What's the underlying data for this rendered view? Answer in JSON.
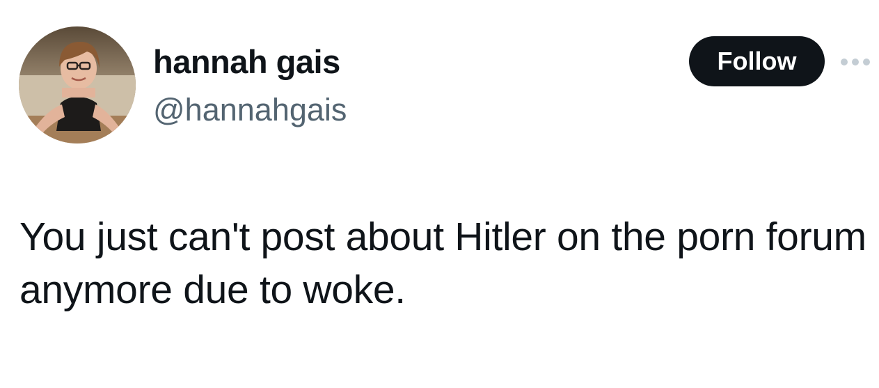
{
  "author": {
    "display_name": "hannah gais",
    "handle": "@hannahgais",
    "avatar_icon": "profile-photo"
  },
  "actions": {
    "follow_label": "Follow",
    "more_icon": "more-options-icon"
  },
  "tweet": {
    "text": "You just can't post about Hitler on the porn forum anymore due to woke."
  },
  "colors": {
    "text_primary": "#0f1419",
    "text_secondary": "#536471",
    "follow_bg": "#0f1419",
    "follow_text": "#ffffff",
    "more_dots": "#c4cdd4"
  }
}
